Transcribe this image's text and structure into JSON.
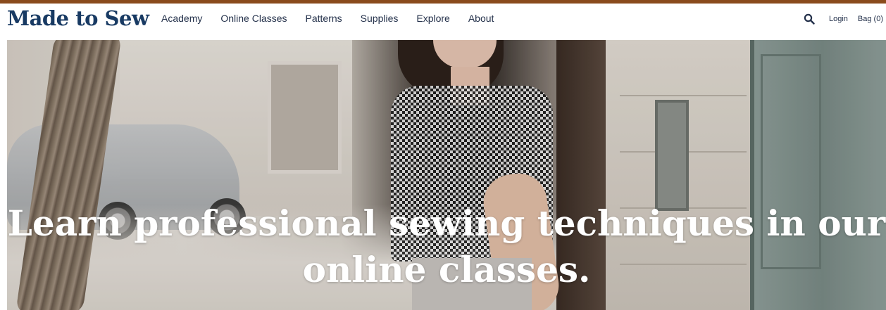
{
  "brand": {
    "logo_text": "Made to Sew",
    "border_color": "#8a4b1c",
    "logo_color": "#183a63"
  },
  "nav": {
    "items": [
      {
        "label": "Academy"
      },
      {
        "label": "Online Classes"
      },
      {
        "label": "Patterns"
      },
      {
        "label": "Supplies"
      },
      {
        "label": "Explore"
      },
      {
        "label": "About"
      }
    ]
  },
  "utility": {
    "search_icon": "search-icon",
    "login_label": "Login",
    "bag_label": "Bag (0)"
  },
  "hero": {
    "heading_line1": "Learn professional sewing techniques in our",
    "heading_line2": "online classes."
  }
}
